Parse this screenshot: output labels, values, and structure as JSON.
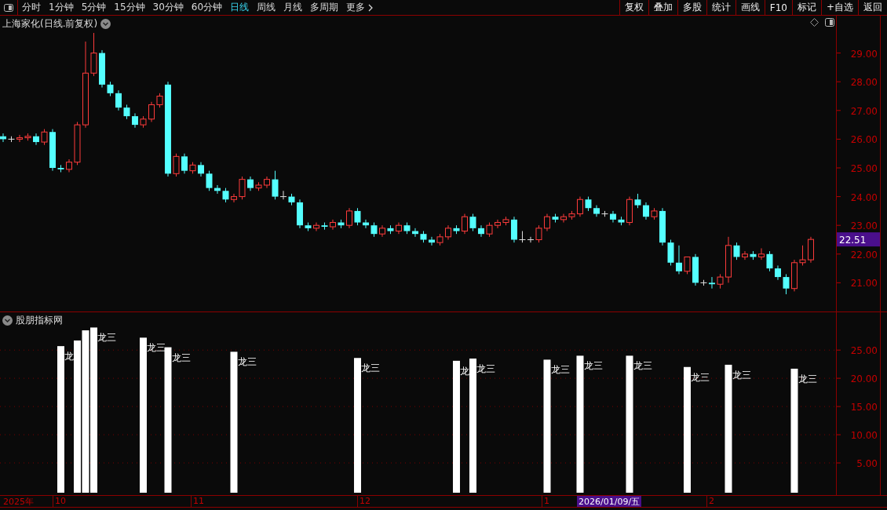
{
  "toolbar": {
    "periods": [
      {
        "label": "分时",
        "selected": false
      },
      {
        "label": "1分钟",
        "selected": false
      },
      {
        "label": "5分钟",
        "selected": false
      },
      {
        "label": "15分钟",
        "selected": false
      },
      {
        "label": "30分钟",
        "selected": false
      },
      {
        "label": "60分钟",
        "selected": false
      },
      {
        "label": "日线",
        "selected": true
      },
      {
        "label": "周线",
        "selected": false
      },
      {
        "label": "月线",
        "selected": false
      },
      {
        "label": "多周期",
        "selected": false
      }
    ],
    "more": "更多",
    "actions": [
      "复权",
      "叠加",
      "多股",
      "统计",
      "画线",
      "F10",
      "标记",
      "+自选",
      "返回"
    ]
  },
  "price_panel": {
    "title": "上海家化(日线.前复权)",
    "last_price": "22.51",
    "axis_labels": [
      "29.00",
      "28.00",
      "27.00",
      "26.00",
      "25.00",
      "24.00",
      "23.00",
      "22.00",
      "21.00"
    ]
  },
  "indicator_panel": {
    "title": "股朋指标网",
    "axis_labels": [
      "25.00",
      "20.00",
      "15.00",
      "10.00",
      "5.00"
    ],
    "signal_labels": [
      "龙",
      "龙三",
      "龙三",
      "龙三",
      "龙三",
      "龙三",
      "龙",
      "龙三",
      "龙三",
      "龙三",
      "龙三",
      "龙三",
      "龙三",
      "龙三"
    ]
  },
  "time_axis": {
    "year_label": "2025年",
    "months": [
      "10",
      "11",
      "12",
      "1",
      "2"
    ],
    "cursor_label": "2026/01/09/五"
  }
}
